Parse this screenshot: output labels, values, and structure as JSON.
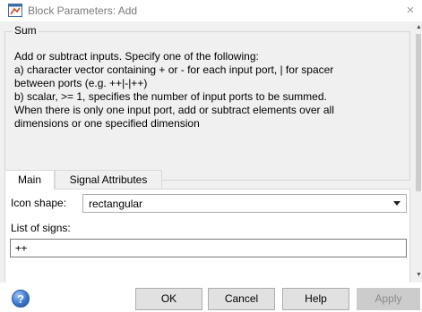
{
  "window": {
    "title": "Block Parameters: Add",
    "close_glyph": "×"
  },
  "group": {
    "legend": "Sum",
    "description_lines": [
      "Add or subtract inputs.  Specify one of the following:",
      "a) character vector containing + or - for each input port, | for spacer",
      "between ports (e.g. ++|-|++)",
      "b) scalar, >= 1, specifies the number of input ports to be summed.",
      "When there is only one input port, add or subtract elements over all",
      "dimensions or one specified dimension"
    ]
  },
  "tabs": [
    {
      "label": "Main",
      "active": true
    },
    {
      "label": "Signal Attributes",
      "active": false
    }
  ],
  "main": {
    "icon_shape_label": "Icon shape:",
    "icon_shape_value": "rectangular",
    "list_of_signs_label": "List of signs:",
    "list_of_signs_value": "++"
  },
  "footer": {
    "help_icon": "?",
    "ok": "OK",
    "cancel": "Cancel",
    "help": "Help",
    "apply": "Apply"
  },
  "icons": {
    "app": "simulink-block-icon",
    "close": "close-icon",
    "help": "help-icon",
    "dropdown": "chevron-down-icon"
  },
  "colors": {
    "panel_bg": "#f0f0f0",
    "help_blue": "#3d78d0",
    "disabled_text": "#8a8a8a"
  }
}
